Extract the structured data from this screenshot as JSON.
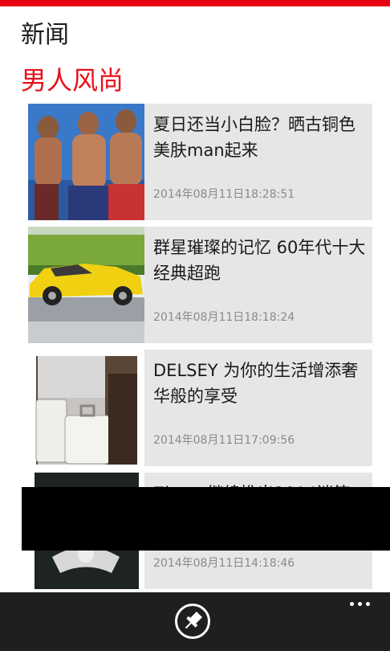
{
  "app": {
    "title": "新闻",
    "section": "男人风尚",
    "accent_color": "#e60012"
  },
  "articles": [
    {
      "title": "夏日还当小白脸？晒古铜色美肤man起来",
      "time": "2014年08月11日18:28:51",
      "image": "three-men-shirtless-photo"
    },
    {
      "title": "群星璀璨的记忆 60年代十大经典超跑",
      "time": "2014年08月11日18:18:24",
      "image": "yellow-sports-car-photo"
    },
    {
      "title": "DELSEY 为你的生活增添奢华般的享受",
      "time": "2014年08月11日17:09:56",
      "image": "white-suitcases-photo"
    },
    {
      "title": "Zippo 继续推出2014迷笛",
      "time": "2014年08月11日14:18:46",
      "image": "zippo-lighter-photo"
    }
  ],
  "appbar": {
    "pin_icon": "pin-icon",
    "more_icon": "ellipsis-icon"
  }
}
